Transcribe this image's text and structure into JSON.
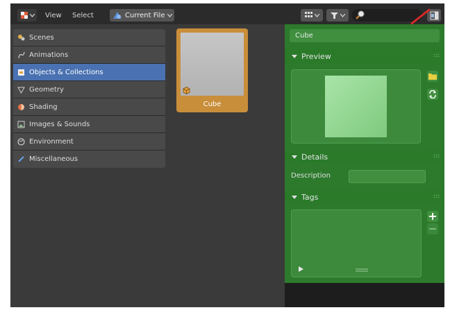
{
  "header": {
    "menu_view": "View",
    "menu_select": "Select",
    "library_label": "Current File"
  },
  "categories": [
    {
      "label": "Scenes",
      "icon": "scenes-icon"
    },
    {
      "label": "Animations",
      "icon": "animations-icon"
    },
    {
      "label": "Objects & Collections",
      "icon": "objects-icon",
      "active": true
    },
    {
      "label": "Geometry",
      "icon": "geometry-icon"
    },
    {
      "label": "Shading",
      "icon": "shading-icon"
    },
    {
      "label": "Images & Sounds",
      "icon": "images-icon"
    },
    {
      "label": "Environment",
      "icon": "environment-icon"
    },
    {
      "label": "Miscellaneous",
      "icon": "miscellaneous-icon"
    }
  ],
  "asset": {
    "label": "Cube"
  },
  "sidebar": {
    "name_value": "Cube",
    "preview_heading": "Preview",
    "details_heading": "Details",
    "description_label": "Description",
    "description_value": "",
    "tags_heading": "Tags"
  },
  "colors": {
    "accent_blue": "#4a72b2",
    "asset_selected": "#c98e3a",
    "sidebar_green": "#2d7a2d",
    "highlight_red": "#d62828"
  }
}
